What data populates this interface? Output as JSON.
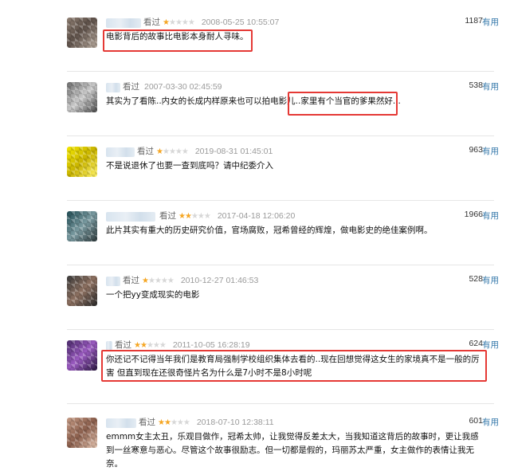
{
  "action_word": "看过",
  "useful_label": "有用",
  "colors": {
    "highlight": "#e53935",
    "star_on": "#f5a623",
    "star_off": "#d7d7d7",
    "link": "#3377aa"
  },
  "reviews": [
    {
      "rating": 1,
      "date": "2008-05-25 10:55:07",
      "votes": "1187",
      "text": "电影背后的故事比电影本身耐人寻味。"
    },
    {
      "rating": 0,
      "date": "2007-03-30 02:45:59",
      "votes": "538",
      "text": "其实为了看陈..内女的长成内样原来也可以拍电影儿..家里有个当官的爹果然好..."
    },
    {
      "rating": 1,
      "date": "2019-08-31 01:45:01",
      "votes": "963",
      "text": "不是说退休了也要一查到底吗？请中纪委介入"
    },
    {
      "rating": 2,
      "date": "2017-04-18 12:06:20",
      "votes": "1966",
      "text": "此片其实有重大的历史研究价值，官场腐败，冠希曾经的辉煌，做电影史的绝佳案例啊。"
    },
    {
      "rating": 1,
      "date": "2010-12-27 01:46:53",
      "votes": "528",
      "text": "一个把yy变成现实的电影"
    },
    {
      "rating": 2,
      "date": "2011-10-05 16:28:19",
      "votes": "624",
      "text": "你还记不记得当年我们是教育局强制学校组织集体去看的..现在回想觉得这女生的家境真不是一般的厉害 但直到现在还很奇怪片名为什么是7小时不是8小时呢"
    },
    {
      "rating": 2,
      "date": "2018-07-10 12:38:11",
      "votes": "601",
      "text": "emmm女主太丑，乐观目做作，冠希太帅，让我觉得反差太大，当我知道这背后的故事时，更让我感到一丝寒意与恶心。尽管这个故事很励志。但一切都是假的，玛丽苏太严重，女主做作的表情让我无奈。"
    }
  ]
}
